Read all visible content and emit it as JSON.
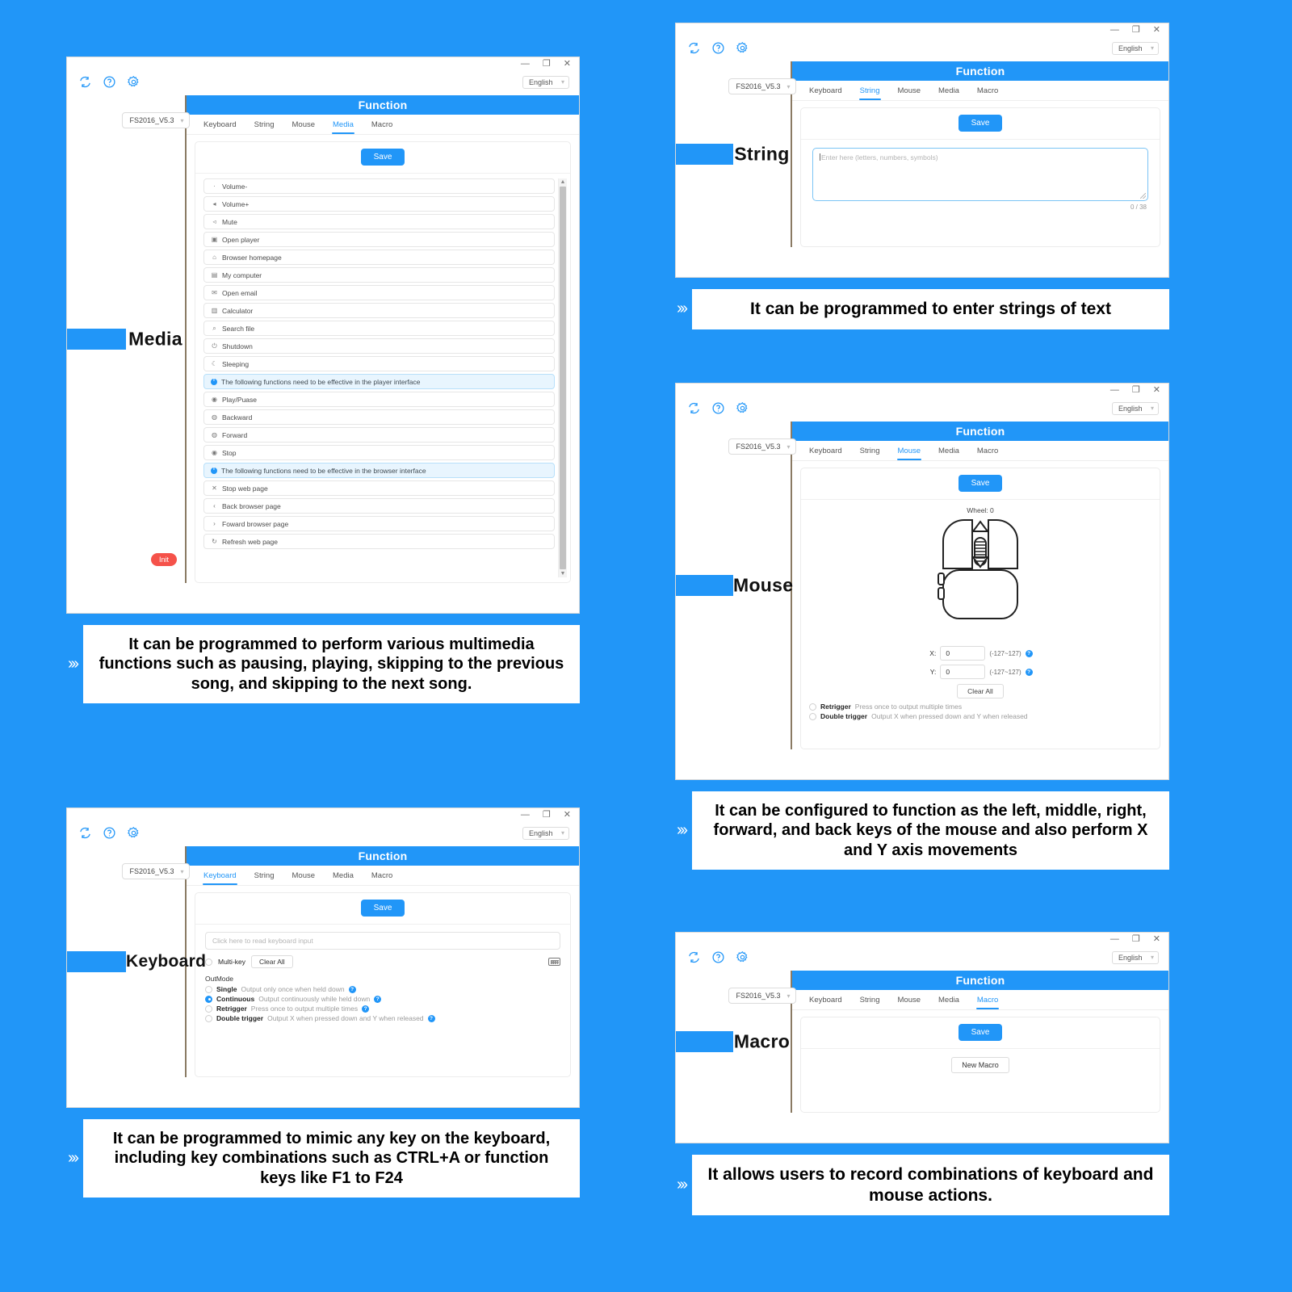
{
  "theme": {
    "accent": "#2196f8",
    "info_bg": "#e8f5fe",
    "init_red": "#f5524a"
  },
  "common": {
    "window_buttons": {
      "minimize": "—",
      "maximize": "❐",
      "close": "✕"
    },
    "language": "English",
    "model": "FS2016_V5.3",
    "function_title": "Function",
    "tabs": [
      "Keyboard",
      "String",
      "Mouse",
      "Media",
      "Macro"
    ],
    "save_label": "Save",
    "icons": {
      "refresh": "refresh-icon",
      "help": "help-icon",
      "settings": "gear-icon"
    }
  },
  "panels": {
    "media": {
      "label": "Media",
      "active_tab": "Media",
      "init_label": "Init",
      "items": [
        {
          "icon": "·",
          "text": "Volume-",
          "type": "item"
        },
        {
          "icon": "◂",
          "text": "Volume+",
          "type": "item"
        },
        {
          "icon": "◃",
          "text": "Mute",
          "type": "item"
        },
        {
          "icon": "▣",
          "text": "Open player",
          "type": "item"
        },
        {
          "icon": "⌂",
          "text": "Browser homepage",
          "type": "item"
        },
        {
          "icon": "▤",
          "text": "My computer",
          "type": "item"
        },
        {
          "icon": "✉",
          "text": "Open email",
          "type": "item"
        },
        {
          "icon": "▥",
          "text": "Calculator",
          "type": "item"
        },
        {
          "icon": "⌕",
          "text": "Search file",
          "type": "item"
        },
        {
          "icon": "⏻",
          "text": "Shutdown",
          "type": "item"
        },
        {
          "icon": "☾",
          "text": "Sleeping",
          "type": "item"
        },
        {
          "icon": "",
          "text": "The following functions need to be effective in the player interface",
          "type": "info"
        },
        {
          "icon": "◉",
          "text": "Play/Puase",
          "type": "item"
        },
        {
          "icon": "◍",
          "text": "Backward",
          "type": "item"
        },
        {
          "icon": "◍",
          "text": "Forward",
          "type": "item"
        },
        {
          "icon": "◉",
          "text": "Stop",
          "type": "item"
        },
        {
          "icon": "",
          "text": "The following functions need to be effective in the browser interface",
          "type": "info"
        },
        {
          "icon": "✕",
          "text": "Stop web page",
          "type": "item"
        },
        {
          "icon": "‹",
          "text": "Back browser page",
          "type": "item"
        },
        {
          "icon": "›",
          "text": "Foward browser page",
          "type": "item"
        },
        {
          "icon": "↻",
          "text": "Refresh web page",
          "type": "item"
        }
      ],
      "caption": "It can be programmed to perform various multimedia functions such as pausing, playing, skipping to the previous song, and skipping to the next song."
    },
    "string": {
      "label": "String",
      "active_tab": "String",
      "placeholder": "Enter here (letters, numbers, symbols)",
      "counter": "0 / 38",
      "caption": "It can be programmed to enter strings of text"
    },
    "mouse": {
      "label": "Mouse",
      "active_tab": "Mouse",
      "wheel_label": "Wheel: 0",
      "x_label": "X:",
      "x_value": "0",
      "x_range": "(-127~127)",
      "y_label": "Y:",
      "y_value": "0",
      "y_range": "(-127~127)",
      "clear_all": "Clear All",
      "options": [
        {
          "name": "Retrigger",
          "desc": "Press once to output multiple times",
          "selected": false
        },
        {
          "name": "Double trigger",
          "desc": "Output X when pressed down and Y when released",
          "selected": false
        }
      ],
      "caption": "It can be configured to function as the left, middle, right, forward, and back keys of the mouse and also perform X and Y axis movements"
    },
    "keyboard": {
      "label": "Keyboard",
      "active_tab": "Keyboard",
      "input_placeholder": "Click here to read keyboard input",
      "multikey_label": "Multi-key",
      "clear_all": "Clear All",
      "outmode_title": "OutMode",
      "outmodes": [
        {
          "name": "Single",
          "desc": "Output only once when held down",
          "selected": false
        },
        {
          "name": "Continuous",
          "desc": "Output continuously while held down",
          "selected": true
        },
        {
          "name": "Retrigger",
          "desc": "Press once to output multiple times",
          "selected": false
        },
        {
          "name": "Double trigger",
          "desc": "Output X when pressed down and Y when released",
          "selected": false
        }
      ],
      "caption": "It can be programmed to mimic any key on the keyboard, including key combinations such as CTRL+A or function keys like F1 to F24"
    },
    "macro": {
      "label": "Macro",
      "active_tab": "Macro",
      "new_macro": "New Macro",
      "caption": "It allows users to record combinations of keyboard and mouse actions."
    }
  }
}
